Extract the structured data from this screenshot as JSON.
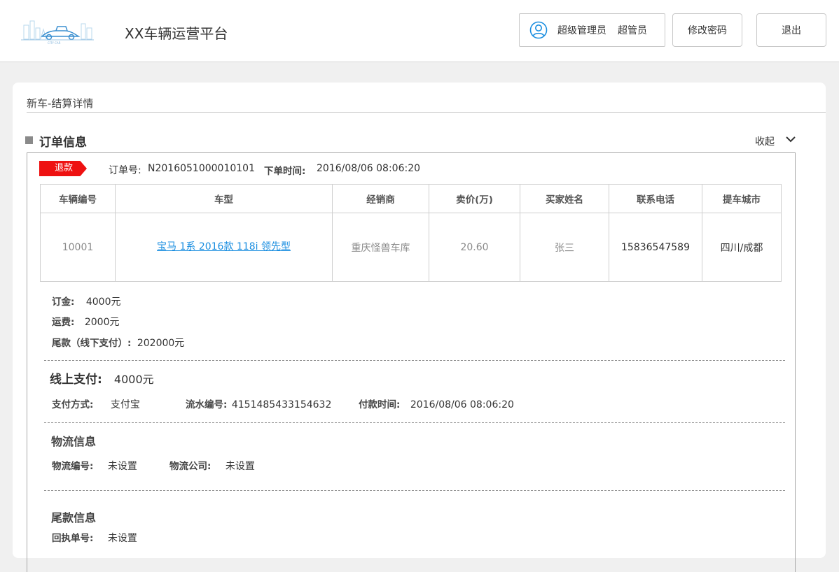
{
  "header": {
    "app_title": "XX车辆运营平台",
    "user_role": "超级管理员",
    "user_name": "超管员",
    "change_password": "修改密码",
    "logout": "退出",
    "logo_icon": "car-city-logo"
  },
  "breadcrumb": "新车-结算详情",
  "order_section": {
    "title": "订单信息",
    "collapse_label": "收起",
    "status_tag": "退款",
    "status_color": "#ee1111",
    "order_no_label": "订单号:",
    "order_no": "N2016051000010101",
    "order_time_label": "下单时间:",
    "order_time": "2016/08/06  08:06:20"
  },
  "table": {
    "headers": [
      "车辆编号",
      "车型",
      "经销商",
      "卖价(万)",
      "买家姓名",
      "联系电话",
      "提车城市"
    ],
    "row": {
      "vehicle_no": "10001",
      "model": "宝马 1系  2016款 118i 领先型",
      "dealer": "重庆怪兽车库",
      "price": "20.60",
      "buyer": "张三",
      "phone": "15836547589",
      "city": "四川/成都"
    }
  },
  "fees": {
    "deposit_label": "订金:",
    "deposit": "4000元",
    "freight_label": "运费:",
    "freight": "2000元",
    "balance_label": "尾款（线下支付）:",
    "balance": "202000元"
  },
  "online_payment": {
    "label": "线上支付:",
    "amount": "4000元",
    "method_label": "支付方式:",
    "method": "支付宝",
    "serial_label": "流水编号:",
    "serial": "4151485433154632",
    "pay_time_label": "付款时间:",
    "pay_time": "2016/08/06  08:06:20"
  },
  "logistics": {
    "title": "物流信息",
    "no_label": "物流编号:",
    "no": "未设置",
    "company_label": "物流公司:",
    "company": "未设置"
  },
  "balance_info": {
    "title": "尾款信息",
    "receipt_label": "回执单号:",
    "receipt": "未设置"
  }
}
